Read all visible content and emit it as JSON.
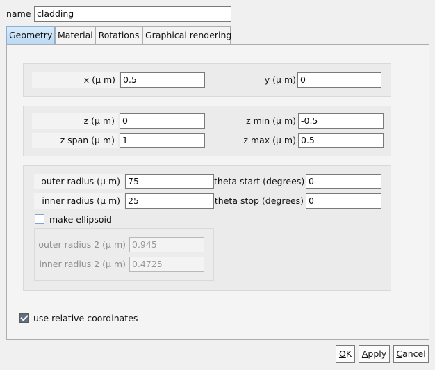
{
  "name": {
    "label": "name",
    "value": "cladding"
  },
  "tabs": [
    {
      "label": "Geometry",
      "active": true
    },
    {
      "label": "Material"
    },
    {
      "label": "Rotations"
    },
    {
      "label": "Graphical rendering"
    }
  ],
  "geometry": {
    "x": {
      "label": "x (μ m)",
      "value": "0.5"
    },
    "y": {
      "label": "y (μ m)",
      "value": "0"
    },
    "z": {
      "label": "z (μ m)",
      "value": "0"
    },
    "z_min": {
      "label": "z min (μ m)",
      "value": "-0.5"
    },
    "z_span": {
      "label": "z span (μ m)",
      "value": "1"
    },
    "z_max": {
      "label": "z max (μ m)",
      "value": "0.5"
    },
    "outer_radius": {
      "label": "outer radius (μ m)",
      "value": "75"
    },
    "inner_radius": {
      "label": "inner radius (μ m)",
      "value": "25"
    },
    "theta_start": {
      "label": "theta start (degrees)",
      "value": "0"
    },
    "theta_stop": {
      "label": "theta stop (degrees)",
      "value": "0"
    },
    "make_ellipsoid": {
      "label": "make ellipsoid",
      "checked": false
    },
    "outer_radius_2": {
      "label": "outer radius 2 (μ m)",
      "value": "0.945"
    },
    "inner_radius_2": {
      "label": "inner radius 2 (μ m)",
      "value": "0.4725"
    }
  },
  "use_relative": {
    "label": "use relative coordinates",
    "checked": true
  },
  "buttons": {
    "ok": {
      "mnemonic": "O",
      "rest": "K"
    },
    "apply": {
      "mnemonic": "A",
      "rest": "pply"
    },
    "cancel": {
      "mnemonic": "C",
      "rest": "ancel"
    }
  }
}
